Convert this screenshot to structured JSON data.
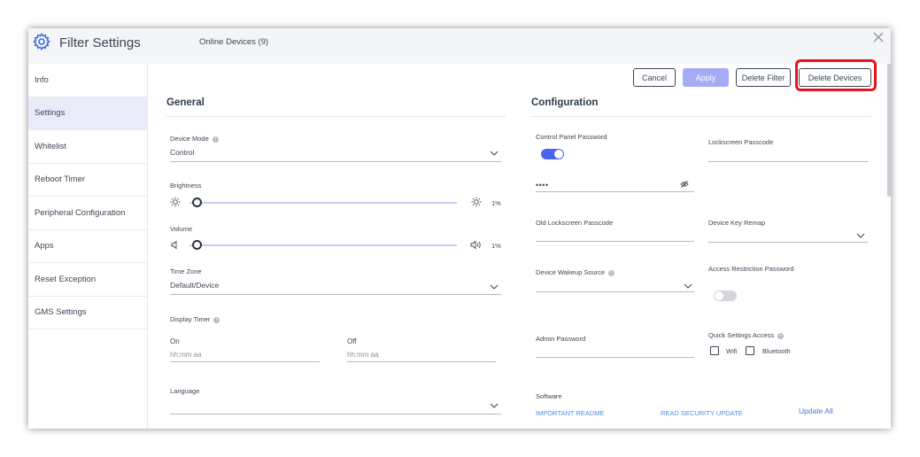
{
  "window": {
    "title": "Filter Settings",
    "online_devices": "Online Devices (9)"
  },
  "sidebar": {
    "items": [
      {
        "label": "Info"
      },
      {
        "label": "Settings"
      },
      {
        "label": "Whitelist"
      },
      {
        "label": "Reboot Timer"
      },
      {
        "label": "Peripheral Configuration"
      },
      {
        "label": "Apps"
      },
      {
        "label": "Reset Exception"
      },
      {
        "label": "GMS Settings"
      }
    ],
    "active": "Settings"
  },
  "toolbar": {
    "cancel_label": "Cancel",
    "apply_label": "Apply",
    "delete_filter_label": "Delete Filter",
    "delete_devices_label": "Delete Devices"
  },
  "general": {
    "title": "General",
    "device_mode": {
      "label": "Device Mode",
      "value": "Control"
    },
    "brightness": {
      "label": "Brightness",
      "value": "1%",
      "level": 0.01
    },
    "volume": {
      "label": "Volume",
      "value": "1%",
      "level": 0.01
    },
    "time_zone": {
      "label": "Time Zone",
      "value": "Default/Device"
    },
    "display_timer": {
      "label": "Display Timer",
      "on_label": "On",
      "on_placeholder": "hh:mm aa",
      "off_label": "Off",
      "off_placeholder": "hh:mm aa"
    },
    "language": {
      "label": "Language",
      "value": ""
    }
  },
  "configuration": {
    "title": "Configuration",
    "control_panel_password": {
      "label": "Control Panel Password",
      "enabled": true,
      "value": "••••"
    },
    "lockscreen_passcode": {
      "label": "Lockscreen Passcode"
    },
    "old_lockscreen_passcode": {
      "label": "Old Lockscreen Passcode"
    },
    "device_key_remap": {
      "label": "Device Key Remap"
    },
    "device_wakeup_source": {
      "label": "Device Wakeup Source"
    },
    "access_restriction_password": {
      "label": "Access Restriction Password",
      "enabled": false
    },
    "admin_password": {
      "label": "Admin Password"
    },
    "quick_settings_access": {
      "label": "Quick Settings Access",
      "options": [
        {
          "label": "Wifi",
          "checked": false
        },
        {
          "label": "Bluetooth",
          "checked": false
        }
      ]
    },
    "software": {
      "label": "Software",
      "important_readme": "IMPORTANT README",
      "read_security_update": "READ SECURITY UPDATE",
      "update_all": "Update All"
    }
  },
  "colors": {
    "accent": "#4864f0",
    "apply_disabled": "#a3acf5",
    "highlight": "#e3161c",
    "link": "#4d8ee8"
  }
}
